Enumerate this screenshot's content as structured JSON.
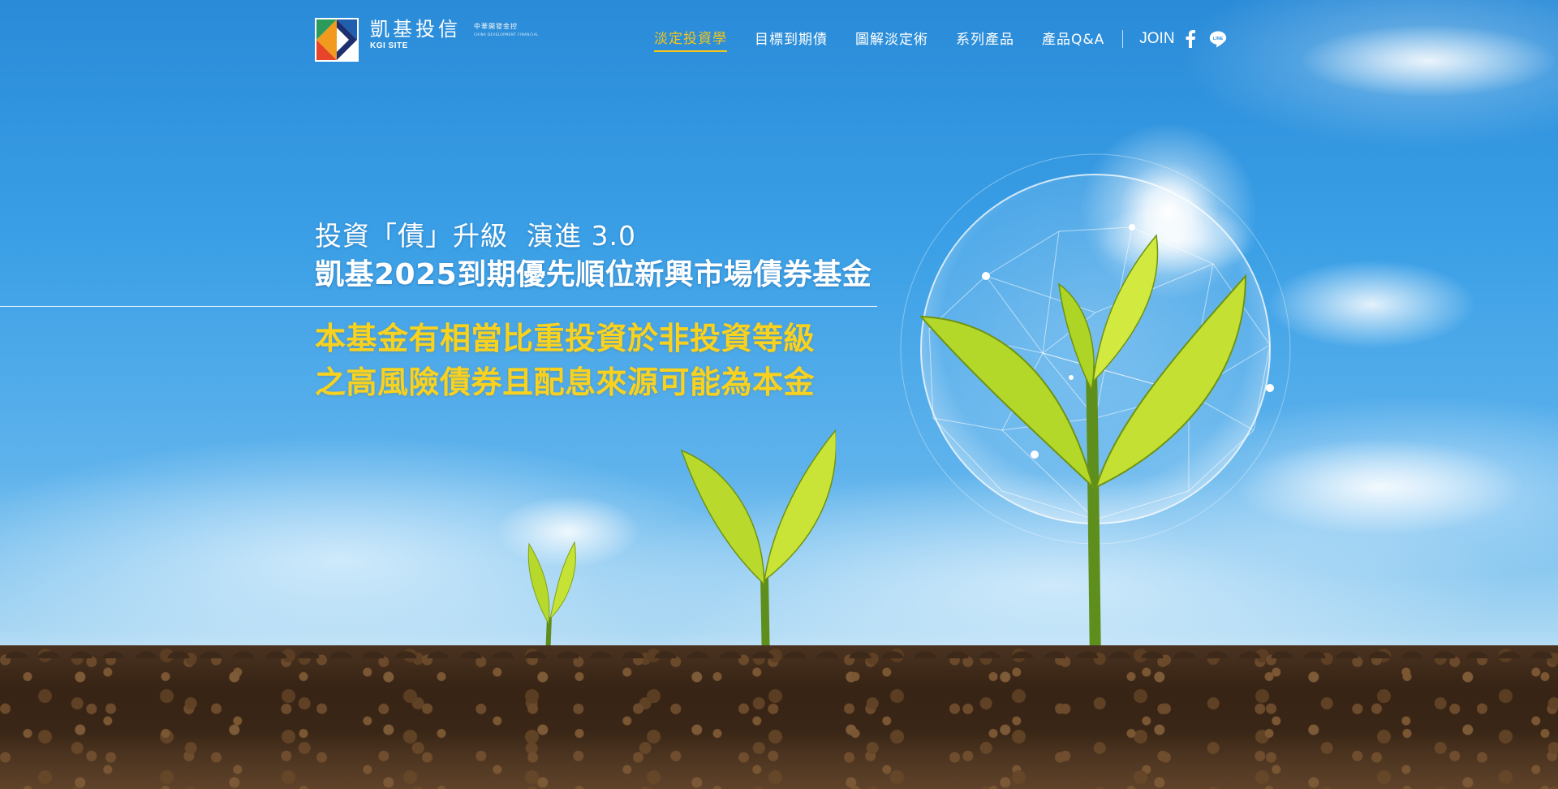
{
  "brand": {
    "name": "凱基投信",
    "sub": "KGI SITE",
    "tag": "中華開發金控",
    "tag_sub": "CHINA DEVELOPMENT FINANCIAL"
  },
  "nav": {
    "items": [
      {
        "label": "淡定投資學",
        "active": true
      },
      {
        "label": "目標到期債",
        "active": false
      },
      {
        "label": "圖解淡定術",
        "active": false
      },
      {
        "label": "系列產品",
        "active": false
      },
      {
        "label": "產品Q&A",
        "active": false
      }
    ],
    "join_label": "JOIN",
    "social": [
      "facebook-icon",
      "line-icon"
    ]
  },
  "hero": {
    "subtitle": "投資「債」升級  演進 3.0",
    "title": "凱基2025到期優先順位新興市場債券基金",
    "warning": [
      "本基金有相當比重投資於非投資等級",
      "之高風險債券且配息來源可能為本金"
    ]
  },
  "colors": {
    "accent": "#f5c518",
    "warning_text": "#f8d21f",
    "sky": "#2f92dd"
  }
}
